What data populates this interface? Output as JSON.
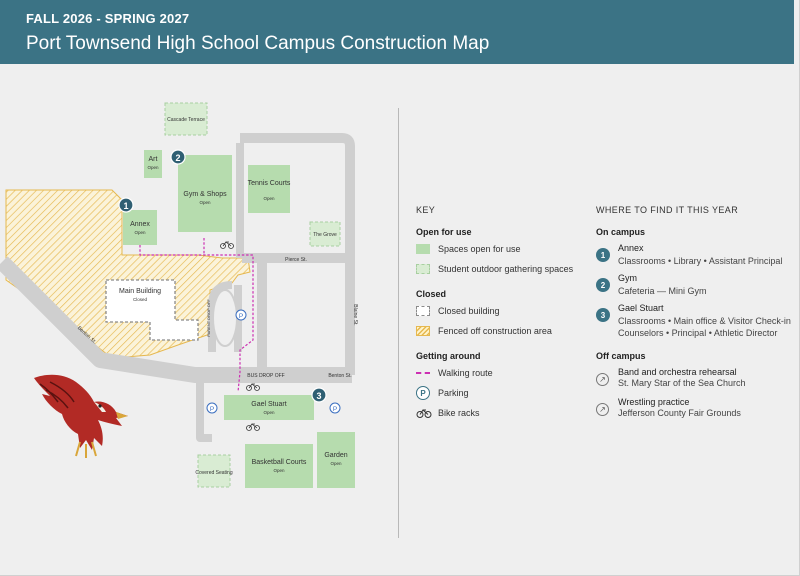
{
  "header": {
    "term": "FALL 2026 - SPRING 2027",
    "title": "Port Townsend High School Campus Construction Map"
  },
  "map": {
    "buildings": {
      "cascade": "Cascade Terrace",
      "art": "Art",
      "art_status": "Open",
      "gym": "Gym & Shops",
      "gym_status": "Open",
      "tennis": "Tennis Courts",
      "tennis_status": "Open",
      "annex": "Annex",
      "annex_status": "Open",
      "grove": "The Grove",
      "main": "Main Building",
      "main_status": "Closed",
      "gael": "Gael Stuart",
      "gael_status": "Open",
      "basketball": "Basketball Courts",
      "basketball_status": "Open",
      "garden": "Garden",
      "garden_status": "Open",
      "covered": "Covered Seating"
    },
    "streets": {
      "pierce": "Pierce St.",
      "benton_left": "Benton St.",
      "benton_right": "Benton St.",
      "blaine": "Blaine St.",
      "bus": "BUS DROP OFF",
      "parent": "PARENT DROP OFF"
    },
    "markers": {
      "annex": "1",
      "gym": "2",
      "gael": "3",
      "parking": "P"
    }
  },
  "key": {
    "heading": "KEY",
    "open_heading": "Open for use",
    "open_items": [
      "Spaces open for use",
      "Student outdoor gathering spaces"
    ],
    "closed_heading": "Closed",
    "closed_items": [
      "Closed building",
      "Fenced off construction area"
    ],
    "around_heading": "Getting around",
    "around_items": [
      "Walking route",
      "Parking",
      "Bike racks"
    ]
  },
  "where": {
    "heading": "WHERE TO FIND IT THIS YEAR",
    "on_heading": "On campus",
    "on": [
      {
        "num": "1",
        "name": "Annex",
        "detail": "Classrooms • Library • Assistant Principal"
      },
      {
        "num": "2",
        "name": "Gym",
        "detail": "Cafeteria — Mini Gym"
      },
      {
        "num": "3",
        "name": "Gael Stuart",
        "detail": "Classrooms • Main office & Visitor Check-in",
        "detail2": "Counselors • Principal • Athletic Director"
      }
    ],
    "off_heading": "Off campus",
    "off": [
      {
        "icon": "arrow-up-right-icon",
        "name": "Band and orchestra rehearsal",
        "detail": "St. Mary Star of the Sea Church"
      },
      {
        "icon": "arrow-up-right-icon",
        "name": "Wrestling practice",
        "detail": "Jefferson County Fair Grounds"
      }
    ]
  },
  "colors": {
    "header": "#3b7385",
    "open": "#b6dcae",
    "gathering": "#d9ecd3",
    "fence": "#e6b84f",
    "walk": "#cc2fb2",
    "road": "#cfcfcf"
  }
}
